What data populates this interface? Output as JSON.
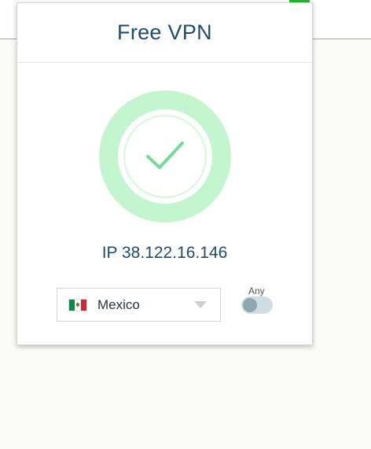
{
  "popup": {
    "title": "Free VPN"
  },
  "status": {
    "connected": true,
    "icon": "checkmark-icon",
    "ring_color": "#c3f6cf",
    "check_color": "#76dc95"
  },
  "connection": {
    "ip_text": "IP 38.122.16.146"
  },
  "location": {
    "selected_country": "Mexico",
    "flag_icon": "mexico-flag-icon"
  },
  "filter": {
    "any_label": "Any",
    "any_enabled": false
  },
  "colors": {
    "title": "#1f4c6b",
    "background": "#fbfcf7"
  }
}
